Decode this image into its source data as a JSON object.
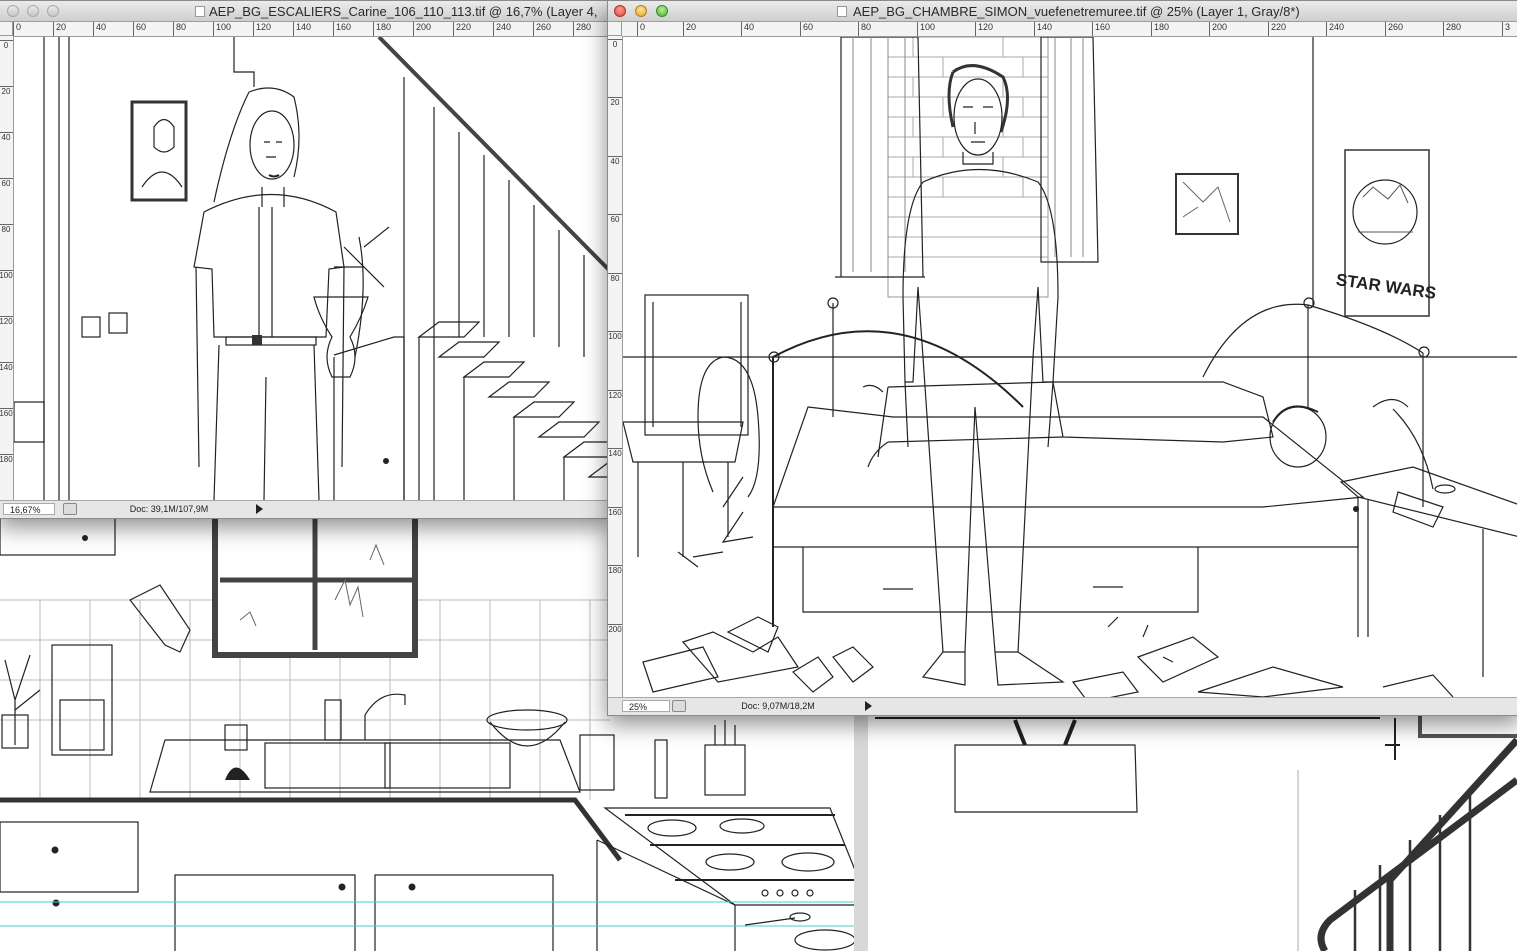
{
  "windows": {
    "escaliers": {
      "title": "AEP_BG_ESCALIERS_Carine_106_110_113.tif @ 16,7% (Layer 4,",
      "ruler_x": [
        "0",
        "20",
        "40",
        "60",
        "80",
        "100",
        "120",
        "140",
        "160",
        "180",
        "200",
        "220",
        "240",
        "260",
        "280"
      ],
      "ruler_y": [
        "0",
        "20",
        "40",
        "60",
        "80",
        "100",
        "120",
        "140",
        "160",
        "180"
      ],
      "zoom": "16,67%",
      "doc_size": "Doc: 39,1M/107,9M"
    },
    "chambre": {
      "title": "AEP_BG_CHAMBRE_SIMON_vuefenetremuree.tif @ 25% (Layer 1, Gray/8*)",
      "ruler_x": [
        "0",
        "20",
        "40",
        "60",
        "80",
        "100",
        "120",
        "140",
        "160",
        "180",
        "200",
        "220",
        "240",
        "260",
        "280",
        "3"
      ],
      "ruler_y": [
        "0",
        "20",
        "40",
        "60",
        "80",
        "100",
        "120",
        "140",
        "160",
        "180",
        "200"
      ],
      "zoom": "25%",
      "doc_size": "Doc: 9,07M/18,2M"
    }
  },
  "background_art": {
    "poster_text": "STAR WARS"
  },
  "icons": [
    "document-icon",
    "traffic-light-close",
    "traffic-light-minimize",
    "traffic-light-zoom",
    "status-menu-arrow"
  ]
}
